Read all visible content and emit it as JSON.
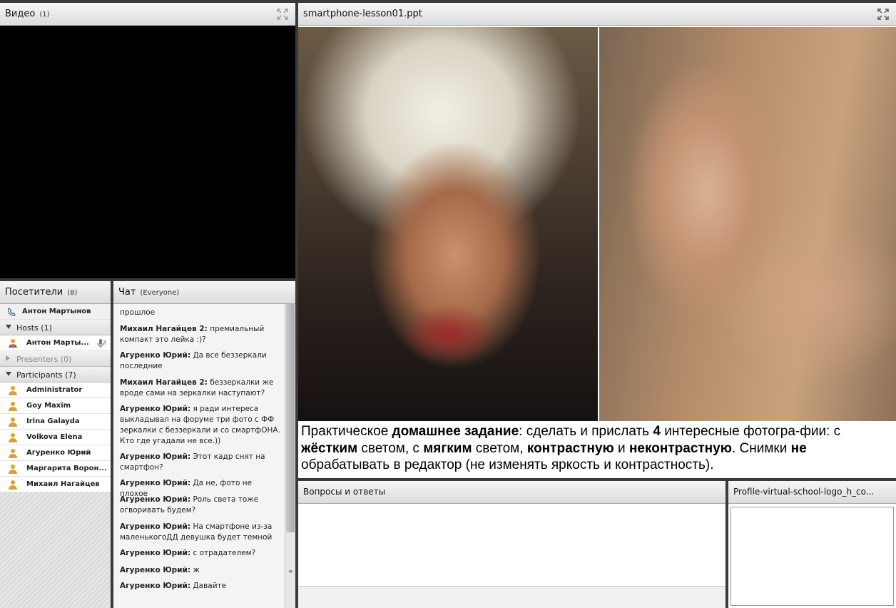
{
  "video": {
    "title": "Видео",
    "count": "(1)"
  },
  "share": {
    "title": "smartphone-lesson01.ppt",
    "slide_text": {
      "p1": "Практическое ",
      "b1": "домашнее задание",
      "p2": ": сделать и прислать ",
      "b2": "4",
      "p3": " интересные фотогра-фии: с ",
      "b3": "жёстким",
      "p4": " светом, с ",
      "b4": "мягким",
      "p5": " светом, ",
      "b5": "контрастную",
      "p6": " и ",
      "b6": "неконтрастную",
      "p7": ". Снимки ",
      "b7": "не",
      "p8": " обрабатывать в редактор (не изменять яркость и контрастность)."
    }
  },
  "attendees": {
    "title": "Посетители",
    "count": "(8)",
    "me": "Антон Мартынов",
    "hosts": {
      "label": "Hosts (1)",
      "items": [
        "Антон Марты..."
      ]
    },
    "presenters": {
      "label": "Presenters (0)"
    },
    "participants": {
      "label": "Participants (7)",
      "items": [
        "Administrator",
        "Goy Maxim",
        "Irina Galayda",
        "Volkova Elena",
        "Агуренко Юрий",
        "Маргарита Ворон...",
        "Михаил Нагайцев"
      ]
    }
  },
  "chat": {
    "title": "Чат",
    "scope": "(Everyone)",
    "messages": [
      {
        "author": "",
        "text": "прошлое"
      },
      {
        "author": "Михаил Нагайцев 2:",
        "text": "премиальный компакт это лейка :)?"
      },
      {
        "author": "Агуренко Юрий:",
        "text": "Да все беззеркали последние"
      },
      {
        "author": "Михаил Нагайцев 2:",
        "text": "беззеркалки же вроде сами на зеркалки наступают?"
      },
      {
        "author": "Агуренко Юрий:",
        "text": "я ради интереса выкладывал на форуме три фото с ФФ зеркалки с беззеркали и со смартфОНА. Кто где угадали не все.))"
      },
      {
        "author": "Агуренко Юрий:",
        "text": "Этот кадр снят на смартфон?"
      },
      {
        "author": "Агуренко Юрий:",
        "text": "Да не, фото не плохое"
      },
      {
        "author": "Агуренко Юрий:",
        "text": "Роль света тоже огворивать будем?"
      },
      {
        "author": "Агуренко Юрий:",
        "text": "На смартфоне из-за маленькогоДД девушка будет темной"
      },
      {
        "author": "Агуренко Юрий:",
        "text": "с отрадателем?"
      },
      {
        "author": "Агуренко Юрий:",
        "text": "ж"
      },
      {
        "author": "Агуренко Юрий:",
        "text": "Давайте"
      }
    ]
  },
  "qa": {
    "title": "Вопросы и ответы"
  },
  "profile": {
    "title": "Profile-virtual-school-logo_h_co..."
  },
  "icons": {
    "maximize": "maximize-icon",
    "phone": "phone-icon",
    "person": "person-icon",
    "mic": "microphone-icon"
  }
}
